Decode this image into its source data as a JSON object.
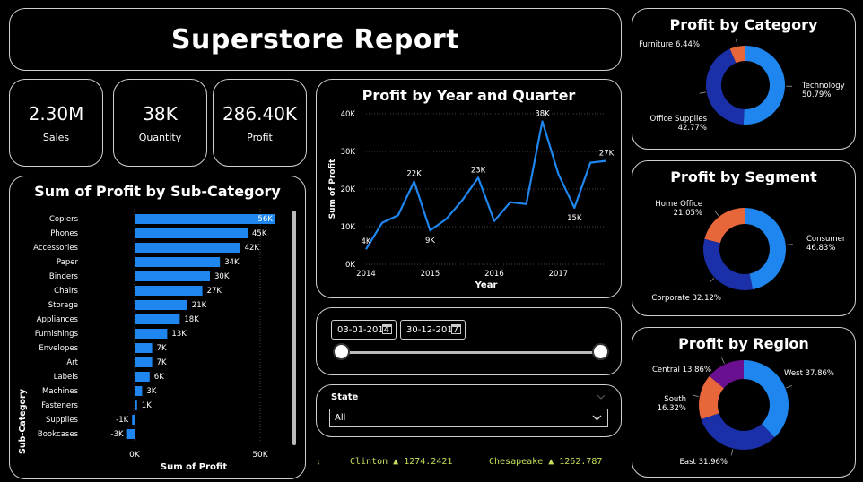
{
  "header": {
    "title": "Superstore Report"
  },
  "kpis": [
    {
      "value": "2.30M",
      "label": "Sales"
    },
    {
      "value": "38K",
      "label": "Quantity"
    },
    {
      "value": "286.40K",
      "label": "Profit"
    }
  ],
  "colors": {
    "primary": "#1f86f0",
    "dark_blue": "#1b2fa8",
    "orange": "#e8673a",
    "purple": "#6a0f8f"
  },
  "subcategory_chart": {
    "title": "Sum of Profit by Sub-Category",
    "xlabel": "Sum of Profit",
    "ylabel": "Sub-Category",
    "x_ticks": [
      "0K",
      "50K"
    ],
    "categories": [
      "Copiers",
      "Phones",
      "Accessories",
      "Paper",
      "Binders",
      "Chairs",
      "Storage",
      "Appliances",
      "Furnishings",
      "Envelopes",
      "Art",
      "Labels",
      "Machines",
      "Fasteners",
      "Supplies",
      "Bookcases"
    ],
    "values": [
      56,
      45,
      42,
      34,
      30,
      27,
      21,
      18,
      13,
      7,
      7,
      6,
      3,
      1,
      -1,
      -3
    ],
    "labels": [
      "56K",
      "45K",
      "42K",
      "34K",
      "30K",
      "27K",
      "21K",
      "18K",
      "13K",
      "7K",
      "7K",
      "6K",
      "3K",
      "1K",
      "-1K",
      "-3K"
    ]
  },
  "line_chart": {
    "title": "Profit by Year and Quarter",
    "xlabel": "Year",
    "ylabel": "Sum of Profit",
    "y_ticks": [
      "0K",
      "10K",
      "20K",
      "30K",
      "40K"
    ],
    "x_ticks": [
      "2014",
      "2015",
      "2016",
      "2017"
    ],
    "values": [
      4,
      11,
      13,
      22,
      9,
      12,
      17,
      23,
      11.5,
      16.5,
      16,
      38,
      24,
      15,
      27,
      27.5
    ],
    "annotations": [
      {
        "index": 0,
        "text": "4K"
      },
      {
        "index": 3,
        "text": "22K"
      },
      {
        "index": 4,
        "text": "9K"
      },
      {
        "index": 7,
        "text": "23K"
      },
      {
        "index": 11,
        "text": "38K"
      },
      {
        "index": 13,
        "text": "15K"
      },
      {
        "index": 15,
        "text": "27K"
      }
    ]
  },
  "date_filter": {
    "start": "03-01-2014",
    "end": "30-12-2017"
  },
  "state_filter": {
    "label": "State",
    "selected": "All"
  },
  "ticker": [
    {
      "text": ";"
    },
    {
      "text": "Clinton ▲ 1274.2421"
    },
    {
      "text": "Chesapeake ▲ 1262.787"
    }
  ],
  "chart_data": [
    {
      "type": "bar",
      "title": "Sum of Profit by Sub-Category",
      "xlabel": "Sum of Profit",
      "ylabel": "Sub-Category",
      "categories": [
        "Copiers",
        "Phones",
        "Accessories",
        "Paper",
        "Binders",
        "Chairs",
        "Storage",
        "Appliances",
        "Furnishings",
        "Envelopes",
        "Art",
        "Labels",
        "Machines",
        "Fasteners",
        "Supplies",
        "Bookcases"
      ],
      "values": [
        56,
        45,
        42,
        34,
        30,
        27,
        21,
        18,
        13,
        7,
        7,
        6,
        3,
        1,
        -1,
        -3
      ],
      "xlim": [
        -3,
        60
      ]
    },
    {
      "type": "line",
      "title": "Profit by Year and Quarter",
      "xlabel": "Year",
      "ylabel": "Sum of Profit",
      "values": [
        4,
        11,
        13,
        22,
        9,
        12,
        17,
        23,
        11.5,
        16.5,
        16,
        38,
        24,
        15,
        27,
        27.5
      ],
      "ylim": [
        0,
        40
      ]
    },
    {
      "type": "pie",
      "title": "Profit by Category",
      "categories": [
        "Technology",
        "Office Supplies",
        "Furniture"
      ],
      "values": [
        50.79,
        42.77,
        6.44
      ],
      "labels": [
        "Technology\n50.79%",
        "Office Supplies\n42.77%",
        "Furniture 6.44%"
      ],
      "colors": [
        "#1f86f0",
        "#1b2fa8",
        "#e8673a"
      ]
    },
    {
      "type": "pie",
      "title": "Profit by Segment",
      "categories": [
        "Consumer",
        "Corporate",
        "Home Office"
      ],
      "values": [
        46.83,
        32.12,
        21.05
      ],
      "labels": [
        "Consumer\n46.83%",
        "Corporate 32.12%",
        "Home Office\n21.05%"
      ],
      "colors": [
        "#1f86f0",
        "#1b2fa8",
        "#e8673a"
      ]
    },
    {
      "type": "pie",
      "title": "Profit by Region",
      "categories": [
        "West",
        "East",
        "South",
        "Central"
      ],
      "values": [
        37.86,
        31.96,
        16.32,
        13.86
      ],
      "labels": [
        "West 37.86%",
        "East 31.96%",
        "South\n16.32%",
        "Central 13.86%"
      ],
      "colors": [
        "#1f86f0",
        "#1b2fa8",
        "#e8673a",
        "#6a0f8f"
      ]
    }
  ]
}
